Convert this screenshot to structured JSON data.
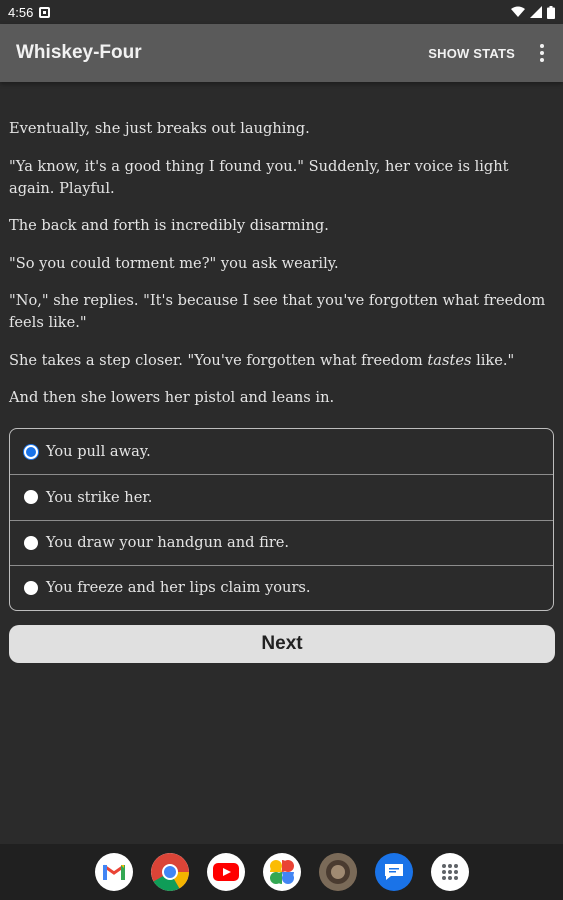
{
  "status_bar": {
    "time": "4:56"
  },
  "app_bar": {
    "title": "Whiskey-Four",
    "show_stats_label": "SHOW STATS"
  },
  "story": {
    "p1": "Eventually, she just breaks out laughing.",
    "p2": "\"Ya know, it's a good thing I found you.\" Suddenly, her voice is light again. Playful.",
    "p3": "The back and forth is incredibly disarming.",
    "p4": "\"So you could torment me?\" you ask wearily.",
    "p5": "\"No,\" she replies. \"It's because I see that you've forgotten what freedom feels like.\"",
    "p6_before": "She takes a step closer. \"You've forgotten what freedom ",
    "p6_em": "tastes",
    "p6_after": " like.\"",
    "p7": "And then she lowers her pistol and leans in."
  },
  "choices": [
    {
      "label": "You pull away.",
      "selected": true
    },
    {
      "label": "You strike her.",
      "selected": false
    },
    {
      "label": "You draw your handgun and fire.",
      "selected": false
    },
    {
      "label": "You freeze and her lips claim yours.",
      "selected": false
    }
  ],
  "next_label": "Next",
  "dock": {
    "icons": [
      "gmail-icon",
      "chrome-icon",
      "youtube-icon",
      "photos-icon",
      "game-app-icon",
      "messages-icon",
      "app-drawer-icon"
    ]
  }
}
